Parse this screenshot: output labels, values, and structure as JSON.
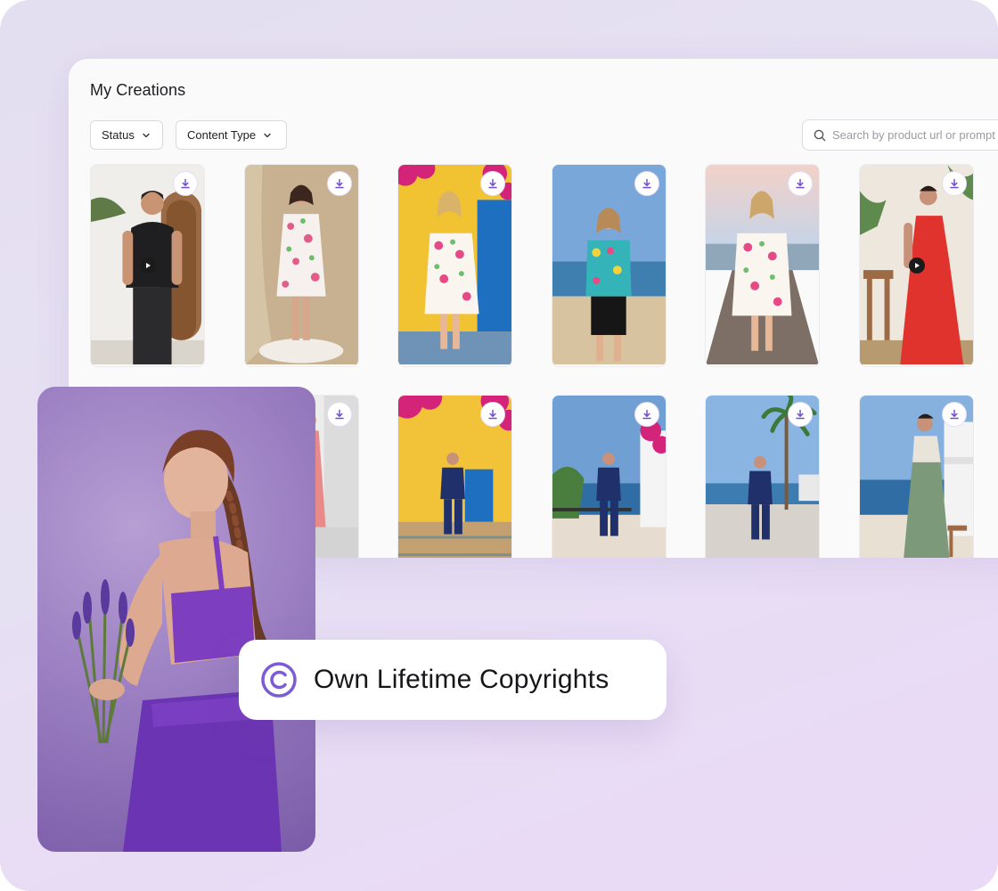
{
  "panel": {
    "title": "My Creations",
    "filters": [
      {
        "label": "Status",
        "icon": "chevron-down-icon"
      },
      {
        "label": "Content Type",
        "icon": "chevron-down-icon"
      }
    ],
    "search": {
      "placeholder": "Search by product url or prompt",
      "icon": "search-icon"
    }
  },
  "cards": [
    {
      "subject": "man in black polo",
      "video": true
    },
    {
      "subject": "woman in floral dress on pedestal",
      "video": false
    },
    {
      "subject": "woman in floral dress at blue door",
      "video": false
    },
    {
      "subject": "woman in floral top on beach",
      "video": false
    },
    {
      "subject": "woman in floral dress on boardwalk",
      "video": false
    },
    {
      "subject": "woman in red gown",
      "video": true
    },
    {
      "subject": "woman in pink dress",
      "video": false
    },
    {
      "subject": "man in navy outfit at blue door",
      "video": false
    },
    {
      "subject": "man in navy outfit on terrace",
      "video": false
    },
    {
      "subject": "man in navy outfit by palms",
      "video": false
    },
    {
      "subject": "woman in green dress on terrace",
      "video": false
    }
  ],
  "badge": {
    "label": "Own Lifetime Copyrights",
    "icon": "copyright-icon",
    "accent": "#7b5bd6"
  }
}
